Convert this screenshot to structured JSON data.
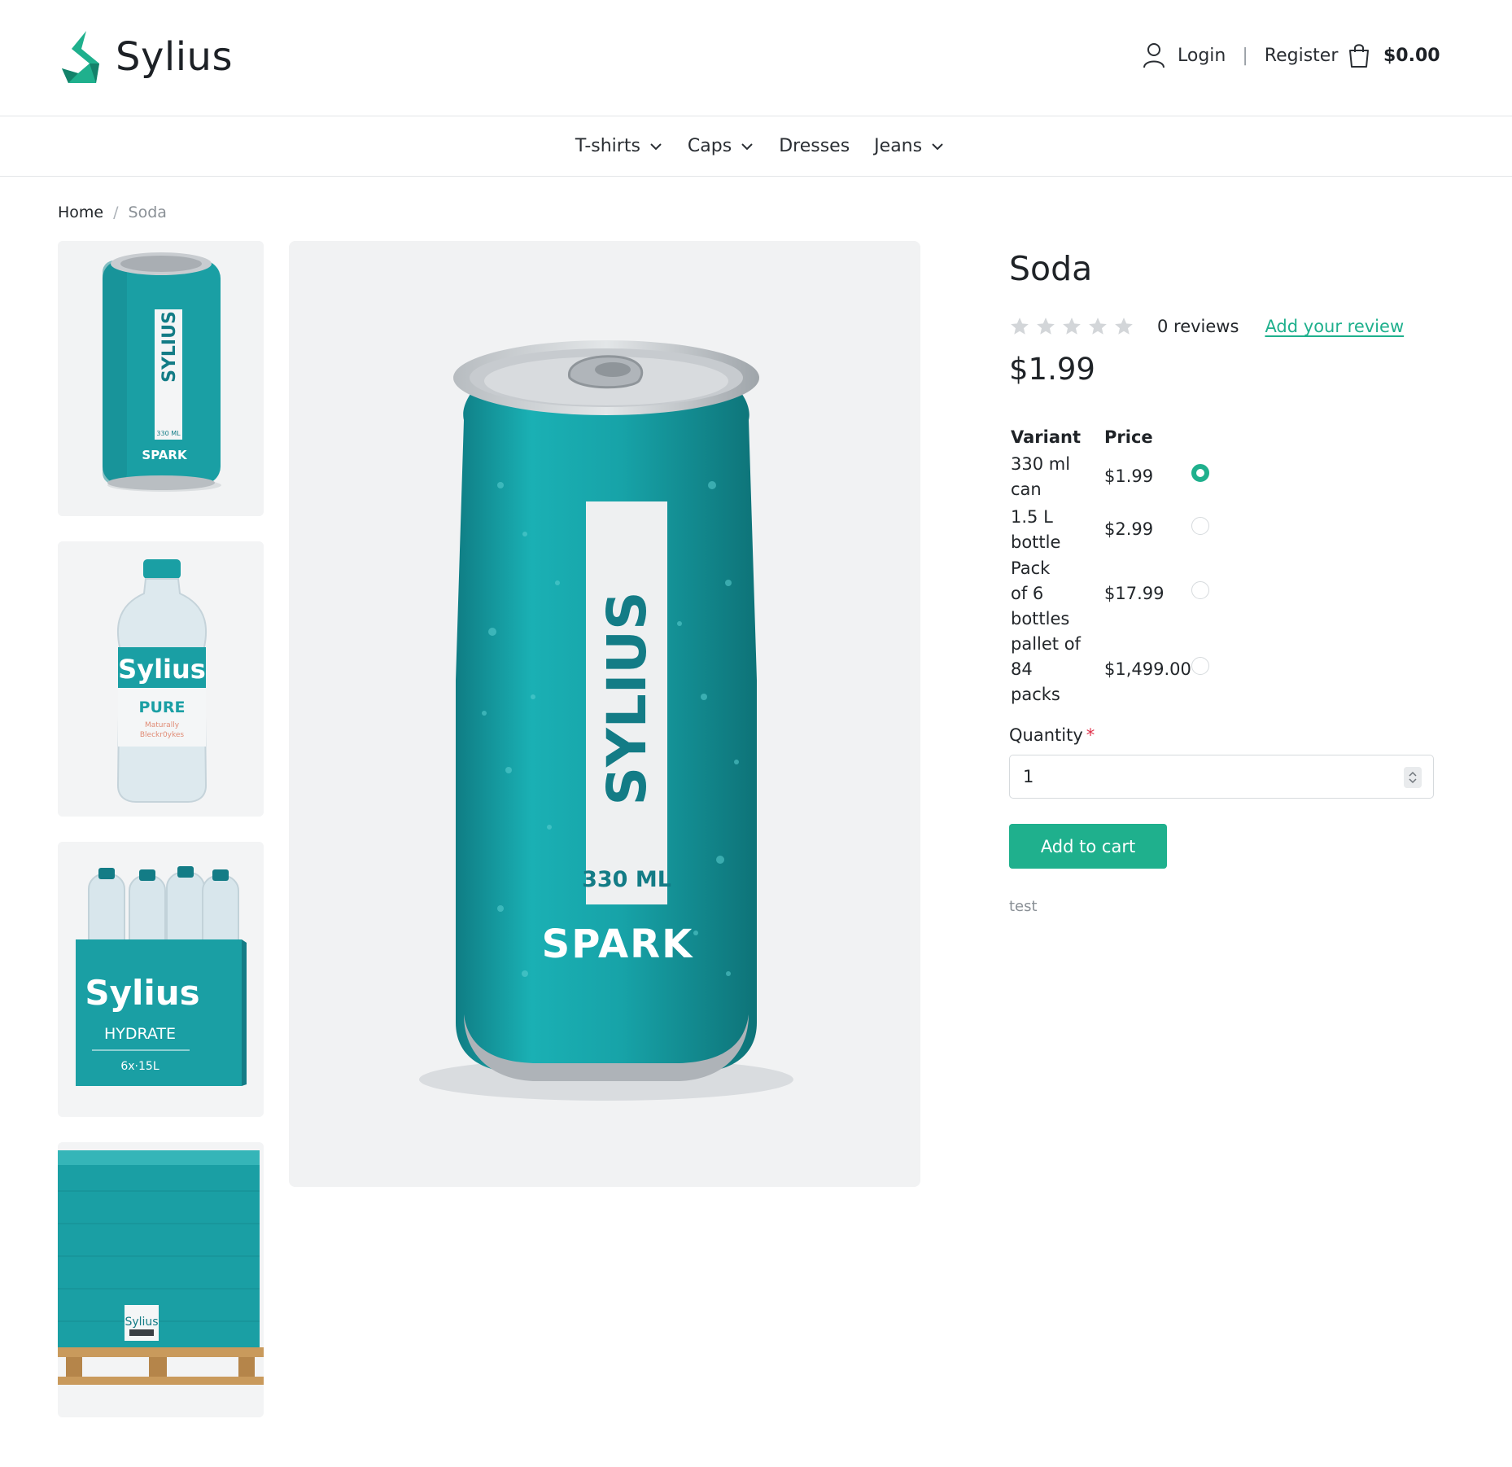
{
  "brand": {
    "name": "Sylius",
    "accent": "#1fb08d"
  },
  "header": {
    "login_label": "Login",
    "separator": "|",
    "register_label": "Register",
    "cart_total": "$0.00",
    "user_icon": "user-icon",
    "cart_icon": "shopping-bag-icon"
  },
  "nav": {
    "items": [
      {
        "label": "T-shirts",
        "has_dropdown": true
      },
      {
        "label": "Caps",
        "has_dropdown": true
      },
      {
        "label": "Dresses",
        "has_dropdown": false
      },
      {
        "label": "Jeans",
        "has_dropdown": true
      }
    ]
  },
  "breadcrumb": {
    "home": "Home",
    "separator": "/",
    "current": "Soda"
  },
  "gallery": {
    "main": {
      "brand_text": "SYLIUS",
      "volume_text": "330 ML",
      "product_text": "SPARK"
    },
    "thumbs": [
      {
        "brand_text": "SYLIUS",
        "volume_text": "330 ML",
        "product_text": "SPARK"
      },
      {
        "brand_text": "Sylius",
        "product_text": "PURE",
        "sub_line1": "Maturally",
        "sub_line2": "Bleckr0ykes"
      },
      {
        "brand_text": "Sylius",
        "product_text": "HYDRATE",
        "sub_text": "6x·15L"
      },
      {
        "brand_text": "Sylius"
      }
    ]
  },
  "product": {
    "title": "Soda",
    "rating": 0,
    "rating_max": 5,
    "reviews_text": "0 reviews",
    "add_review_label": "Add your review",
    "price": "$1.99",
    "variants_header": {
      "variant": "Variant",
      "price": "Price"
    },
    "variants": [
      {
        "line1": "330 ml",
        "line2": "can",
        "price": "$1.99",
        "selected": true
      },
      {
        "line1": "1.5 L",
        "line2": "bottle",
        "price": "$2.99",
        "selected": false
      },
      {
        "line1": "Pack",
        "line2": "of 6 bottles",
        "price": "$17.99",
        "selected": false
      },
      {
        "line1": "pallet of 84",
        "line2": "packs",
        "price": "$1,499.00",
        "selected": false
      }
    ],
    "quantity_label": "Quantity",
    "required_mark": "*",
    "quantity_value": "1",
    "add_to_cart_label": "Add to cart",
    "description": "test"
  }
}
